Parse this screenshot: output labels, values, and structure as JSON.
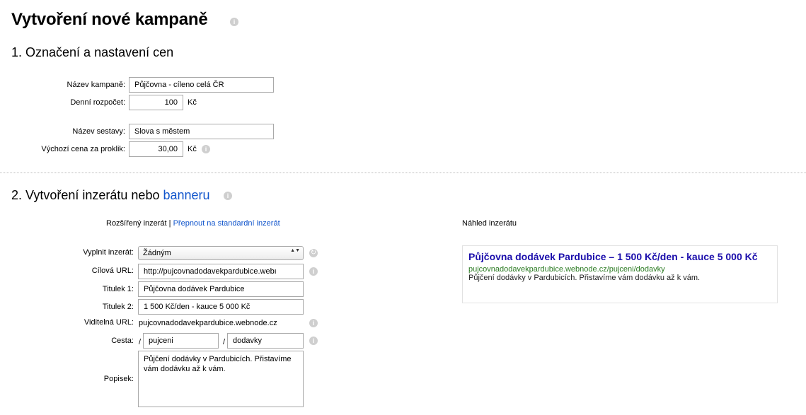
{
  "page": {
    "title": "Vytvoření nové kampaně"
  },
  "section1": {
    "title": "1. Označení a nastavení cen",
    "campaign_name_label": "Název kampaně:",
    "campaign_name_value": "Půjčovna - cíleno celá ČR",
    "daily_budget_label": "Denní rozpočet:",
    "daily_budget_value": "100",
    "daily_budget_unit": "Kč",
    "group_name_label": "Název sestavy:",
    "group_name_value": "Slova s městem",
    "default_cpc_label": "Výchozí cena za proklik:",
    "default_cpc_value": "30,00",
    "default_cpc_unit": "Kč"
  },
  "section2": {
    "title_prefix": "2. Vytvoření inzerátu nebo ",
    "title_link": "banneru",
    "ad_type_label": "Rozšířený inzerát",
    "ad_type_separator": "|",
    "switch_link": "Přepnout na standardní inzerát",
    "preview_heading": "Náhled inzerátu",
    "fill_label": "Vyplnit inzerát:",
    "fill_value": "Žádným",
    "target_url_label": "Cílová URL:",
    "target_url_value": "http://pujcovnadodavekpardubice.webı",
    "title1_label": "Titulek 1:",
    "title1_value": "Půjčovna dodávek Pardubice",
    "title2_label": "Titulek 2:",
    "title2_value": "1 500 Kč/den - kauce 5 000 Kč",
    "visible_url_label": "Viditelná URL:",
    "visible_url_value": "pujcovnadodavekpardubice.webnode.cz",
    "path_label": "Cesta:",
    "path_sep": "/",
    "path1_value": "pujceni",
    "path2_value": "dodavky",
    "description_label": "Popisek:",
    "description_value": "Půjčení dodávky v Pardubicích. Přistavíme vám dodávku až k vám."
  },
  "preview": {
    "headline": "Půjčovna dodávek Pardubice – 1 500 Kč/den - kauce 5 000 Kč",
    "url": "pujcovnadodavekpardubice.webnode.cz/pujceni/dodavky",
    "description": "Půjčení dodávky v Pardubicích. Přistavíme vám dodávku až k vám."
  },
  "icons": {
    "info": "info-icon",
    "refresh": "refresh-icon",
    "info_glyph": "i",
    "refresh_glyph": "↻",
    "select_arrows": "▲▼"
  },
  "colors": {
    "link": "#1155cc",
    "ad_headline": "#1a0dab",
    "ad_url": "#2a7a21"
  }
}
